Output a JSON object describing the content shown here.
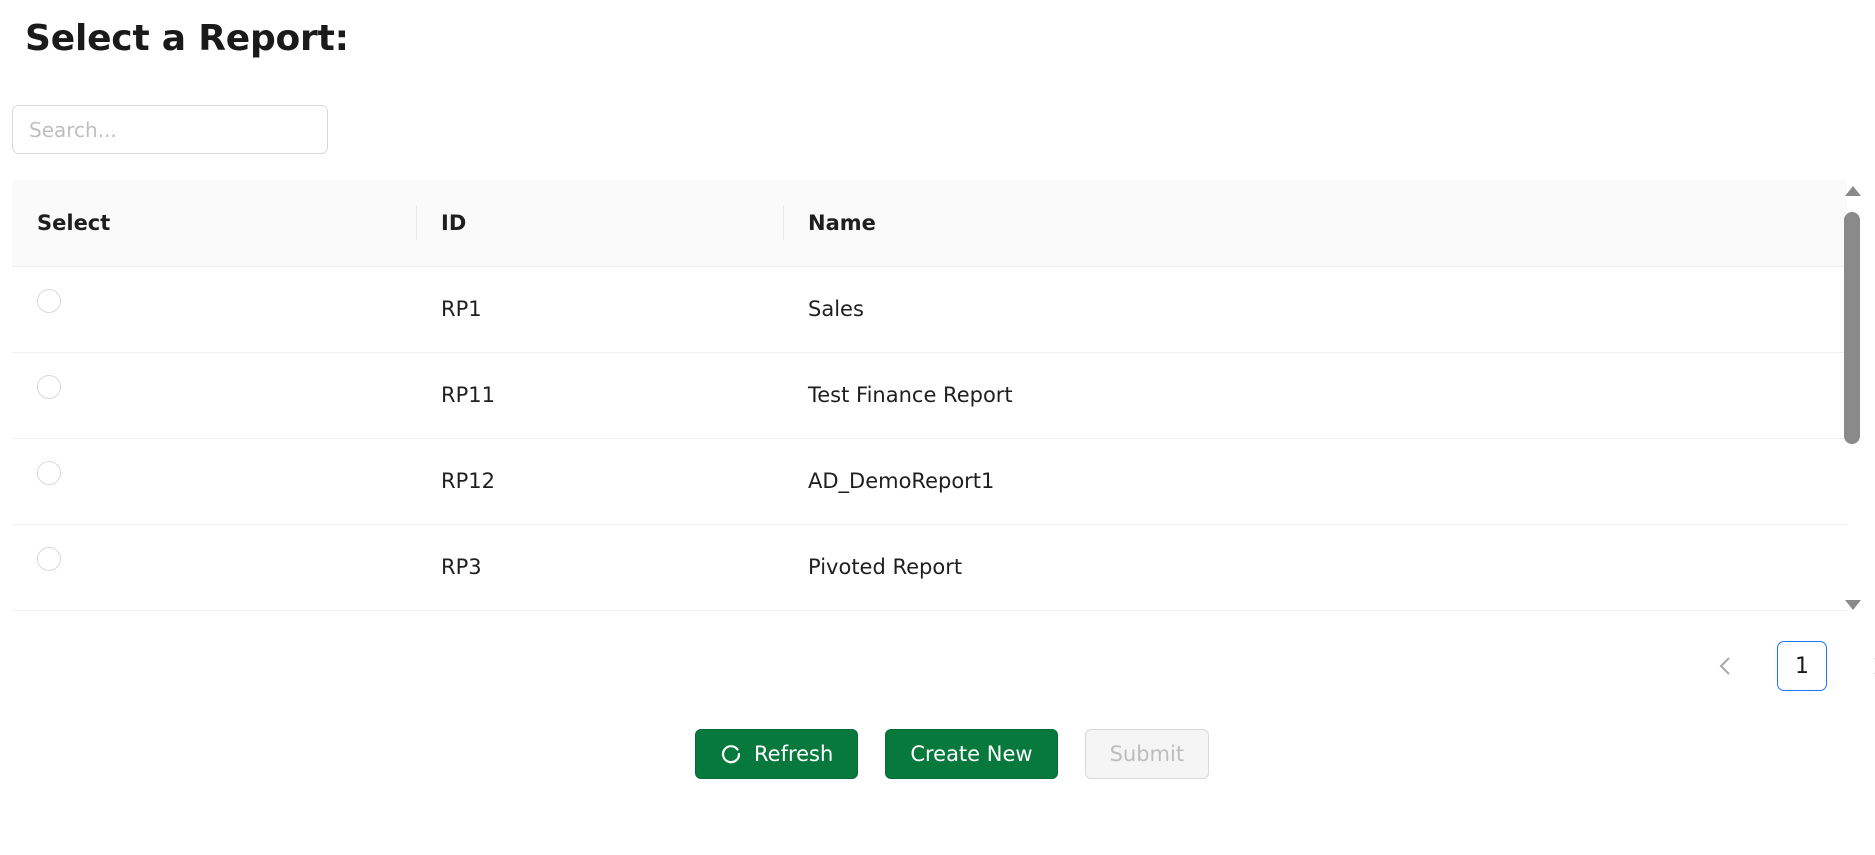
{
  "page": {
    "title": "Select a Report:"
  },
  "search": {
    "placeholder": "Search...",
    "value": ""
  },
  "table": {
    "columns": [
      "Select",
      "ID",
      "Name"
    ],
    "rows": [
      {
        "id": "RP1",
        "name": "Sales",
        "selected": false
      },
      {
        "id": "RP11",
        "name": "Test Finance Report",
        "selected": false
      },
      {
        "id": "RP12",
        "name": "AD_DemoReport1",
        "selected": false
      },
      {
        "id": "RP3",
        "name": "Pivoted Report",
        "selected": false
      }
    ]
  },
  "pagination": {
    "prev_icon": "chevron-left-icon",
    "current_page": "1",
    "next_icon": "chevron-right-icon"
  },
  "actions": {
    "refresh_label": "Refresh",
    "refresh_icon": "refresh-icon",
    "create_label": "Create New",
    "submit_label": "Submit",
    "submit_disabled": true
  },
  "colors": {
    "primary": "#07793d",
    "pagination_active_border": "#1677ff"
  }
}
